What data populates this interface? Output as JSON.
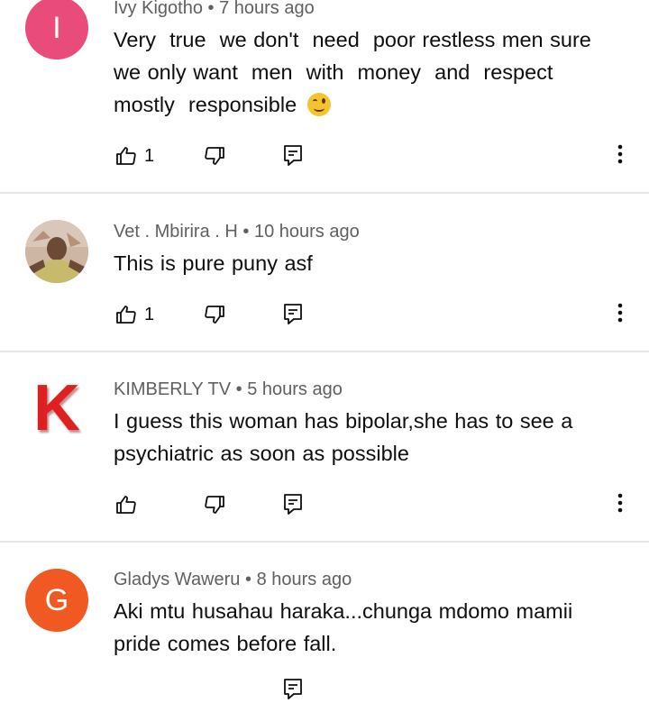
{
  "comments": [
    {
      "avatar_letter": "I",
      "avatar_color": "#e94b7a",
      "author": "Ivy Kigotho",
      "time": "7 hours ago",
      "text": "Very  true  we don't  need  poor restless men sure\nwe only want  men  with  money  and  respect\nmostly  responsible",
      "emoji": "winking-face-emoji",
      "likes": "1"
    },
    {
      "avatar_letter": "",
      "avatar_color": "#b89a86",
      "author": "Vet . Mbirira . H",
      "time": "10 hours ago",
      "text": "This is pure puny asf",
      "likes": "1"
    },
    {
      "avatar_letter": "K",
      "avatar_color": "#e02020",
      "author": "KIMBERLY TV",
      "time": "5 hours ago",
      "text": "I guess this woman has bipolar,she has to see a\npsychiatric as soon as possible",
      "likes": ""
    },
    {
      "avatar_letter": "G",
      "avatar_color": "#f05a22",
      "author": "Gladys Waweru",
      "time": "8 hours ago",
      "text": "Aki mtu husahau haraka...chunga mdomo mamii\npride comes before fall.",
      "likes": ""
    }
  ],
  "separator": "•",
  "icons": {
    "like": "thumbs-up-icon",
    "dislike": "thumbs-down-icon",
    "reply": "reply-icon",
    "more": "more-vert-icon"
  }
}
